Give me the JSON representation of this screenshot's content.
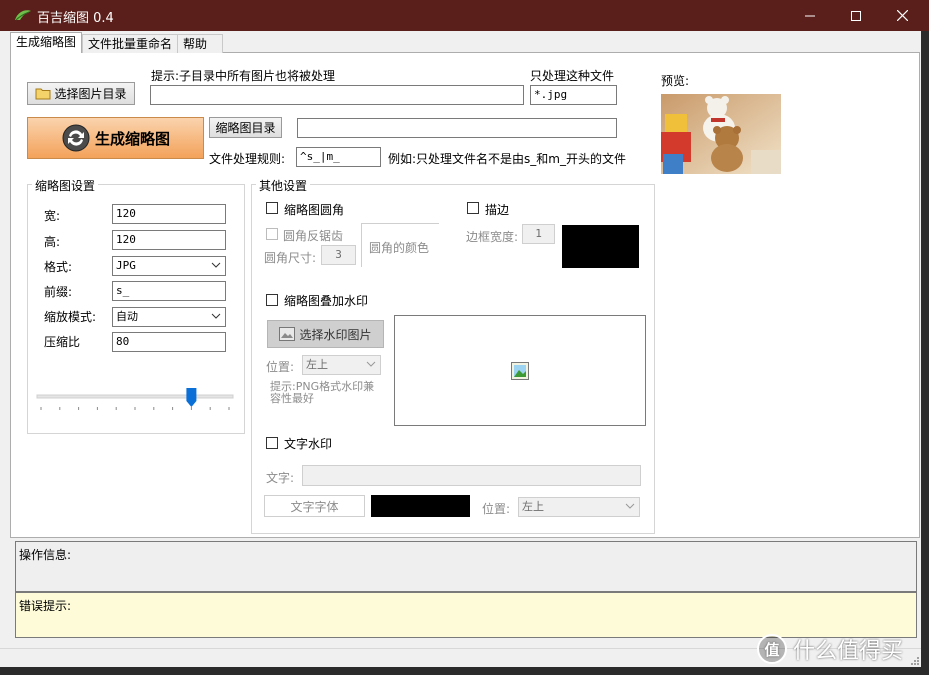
{
  "window": {
    "title": "百吉缩图 0.4"
  },
  "tabs": [
    {
      "label": "生成缩略图",
      "active": true
    },
    {
      "label": "文件批量重命名",
      "active": false
    },
    {
      "label": "帮助",
      "active": false
    }
  ],
  "top": {
    "select_dir_button": "选择图片目录",
    "hint_label": "提示:子目录中所有图片也将被处理",
    "dir_path_value": "",
    "filter_label": "只处理这种文件",
    "filter_value": "*.jpg",
    "preview_label": "预览:",
    "generate_button": "生成缩略图",
    "thumb_dir_button": "缩略图目录",
    "thumb_dir_value": "",
    "rule_label": "文件处理规则:",
    "rule_value": "^s_|m_",
    "rule_example": "例如:只处理文件名不是由s_和m_开头的文件"
  },
  "thumb_settings": {
    "title": "缩略图设置",
    "width_label": "宽:",
    "width_value": "120",
    "height_label": "高:",
    "height_value": "120",
    "format_label": "格式:",
    "format_value": "JPG",
    "prefix_label": "前缀:",
    "prefix_value": "s_",
    "scale_label": "缩放模式:",
    "scale_value": "自动",
    "quality_label": "压缩比",
    "quality_value": "80",
    "quality_slider_fraction": 0.8
  },
  "other_settings": {
    "title": "其他设置",
    "round_corner_label": "缩略图圆角",
    "antialias_label": "圆角反锯齿",
    "corner_size_label": "圆角尺寸:",
    "corner_size_value": "3",
    "corner_color_label": "圆角的颜色",
    "border_label": "描边",
    "border_width_label": "边框宽度:",
    "border_width_value": "1",
    "border_color": "#000000",
    "watermark_label": "缩略图叠加水印",
    "watermark_button": "选择水印图片",
    "position_label": "位置:",
    "position_value": "左上",
    "png_hint": "提示:PNG格式水印兼容性最好",
    "text_watermark_label": "文字水印",
    "text_label": "文字:",
    "text_value": "",
    "font_button": "文字字体",
    "font_color": "#000000",
    "text_position_label": "位置:",
    "text_position_value": "左上"
  },
  "status": {
    "info_label": "操作信息:",
    "error_label": "错误提示:"
  },
  "watermark": {
    "logo": "值",
    "text": "什么值得买"
  }
}
